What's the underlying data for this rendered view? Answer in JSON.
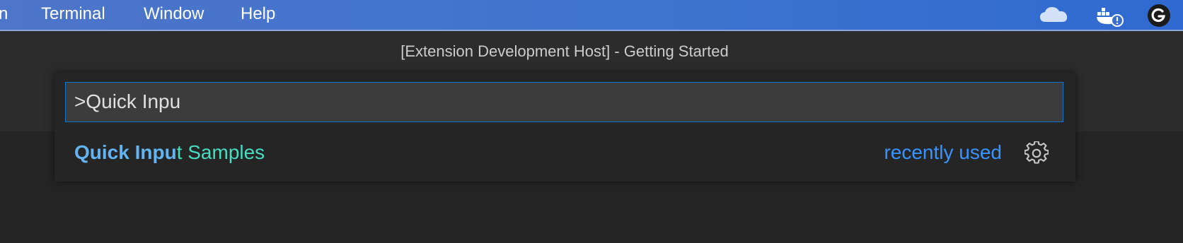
{
  "menubar": {
    "items": [
      "n",
      "Terminal",
      "Window",
      "Help"
    ],
    "tray_icons": [
      "onedrive-cloud-icon",
      "docker-warning-icon",
      "grammarly-icon"
    ]
  },
  "window": {
    "title": "[Extension Development Host] - Getting Started"
  },
  "quick_input": {
    "value": ">Quick Inpu",
    "items": [
      {
        "label_highlight": "Quick Inpu",
        "label_rest": "t Samples",
        "description": "recently used",
        "action_icon": "gear-icon"
      }
    ]
  },
  "colors": {
    "menubar_accent": "#3f73cf",
    "input_border": "#0e74c9",
    "highlight": "#62b3f0",
    "label": "#48dcc0",
    "description": "#3794ff"
  }
}
